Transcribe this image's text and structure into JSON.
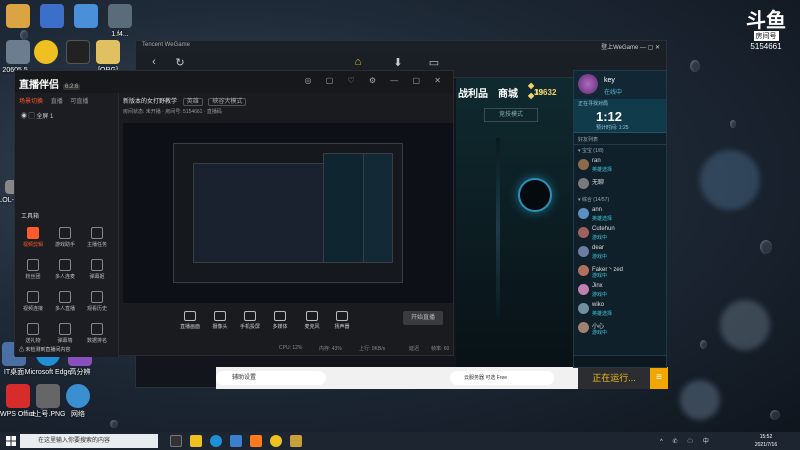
{
  "desktop": {
    "icons": [
      {
        "label": "",
        "color": "#d9a441"
      },
      {
        "label": "",
        "color": "#3b6fc9"
      },
      {
        "label": "",
        "color": "#4a90d9"
      },
      {
        "label": "1.f4...",
        "color": "#d04040"
      },
      {
        "label": "20605 5...",
        "color": "#5a6b7a"
      },
      {
        "label": "文件...",
        "color": "#5c8cd6"
      },
      {
        "label": "",
        "color": "#f0c020"
      },
      {
        "label": "",
        "color": "#222"
      },
      {
        "label": "",
        "color": "#e0c060"
      },
      {
        "label": "[ORG]",
        "color": "#c7a34b"
      },
      {
        "label": "202...",
        "color": "#6a7b8a"
      },
      {
        "label": "LOL-M...",
        "color": "#888"
      },
      {
        "label": "IT桌面",
        "color": "#4a6fa5"
      },
      {
        "label": "Microsoft Edge",
        "color": "#1f8fd6"
      },
      {
        "label": "高分辨",
        "color": "#8a4fbf"
      },
      {
        "label": "WPS Office",
        "color": "#d62c2c"
      },
      {
        "label": "d上号.PNG",
        "color": "#666"
      },
      {
        "label": "网络",
        "color": "#3a8fd0"
      }
    ]
  },
  "brand": {
    "mark": "斗鱼",
    "tag": "房间号",
    "room": "5154661"
  },
  "wegame": {
    "title": "Tencent WeGame",
    "window_right": "登上WeGame",
    "nav_icons": [
      "back-arrow-icon",
      "refresh-icon",
      "home-icon",
      "download-icon",
      "monitor-icon"
    ],
    "tabs": [
      "战利品",
      "商城"
    ],
    "stats": {
      "rp": "39",
      "be": "13632"
    },
    "game_button": "竞技模式",
    "assist_label": "辅助设置",
    "chip_label": "云服务器 可选 Free",
    "run_label": "正在运行...",
    "menu_icon": "≡"
  },
  "friends": {
    "name": "key",
    "status": "在线中",
    "timer_label": "正在寻找对局",
    "timer": "1:12",
    "timer_sub": "预计时间: 1:25",
    "search": "好友列表",
    "group1": "▾ 宝宝 (1/8)",
    "group2": "▾ 综合 (14/57)",
    "rows": [
      {
        "name": "ran",
        "status": "英雄选择",
        "color": "#8b6b4a"
      },
      {
        "name": "无聊",
        "status": "",
        "color": "#7a7a7a"
      },
      {
        "name": "ann",
        "status": "英雄选择",
        "color": "#5a8fc0"
      },
      {
        "name": "Cutehun",
        "status": "游戏中",
        "color": "#a06060"
      },
      {
        "name": "dear",
        "status": "游戏中",
        "color": "#6b7da0"
      },
      {
        "name": "Faker丶zed",
        "status": "游戏中",
        "color": "#b07060"
      },
      {
        "name": "Jinx",
        "status": "游戏中",
        "color": "#c080b0"
      },
      {
        "name": "wiko",
        "status": "英雄选择",
        "color": "#7090a0"
      },
      {
        "name": "小心",
        "status": "游戏中",
        "color": "#a08070"
      }
    ]
  },
  "stream": {
    "logo": "直播伴侣",
    "version": "6.2.6",
    "tabs": [
      "场景切换",
      "直播",
      "可直播"
    ],
    "scene": "◉  ▢  全屏 1",
    "room_title": "新版本的女打野教学",
    "category": "英雄",
    "tag": "峡谷大模式",
    "info": "房间状态: 未开播  ·  房间号: 5154661  ·  直播码",
    "tools_title": "工具箱",
    "tools": [
      {
        "label": "视频剪辑",
        "hot": true
      },
      {
        "label": "游戏助手",
        "hot": false
      },
      {
        "label": "主播任务",
        "hot": false
      },
      {
        "label": "粉丝团",
        "hot": false
      },
      {
        "label": "多人连麦",
        "hot": false
      },
      {
        "label": "弹幕姬",
        "hot": false
      },
      {
        "label": "视频连接",
        "hot": false
      },
      {
        "label": "多人直播",
        "hot": false
      },
      {
        "label": "观看历史",
        "hot": false
      },
      {
        "label": "送礼物",
        "hot": false
      },
      {
        "label": "弹幕墙",
        "hot": false
      },
      {
        "label": "数据排名",
        "hot": false
      }
    ],
    "warn": "⚠ 未检测到直播间内容",
    "controls": [
      "直播画面",
      "摄像头",
      "手机投屏",
      "多媒体",
      "麦克风",
      "扬声器"
    ],
    "start": "开始直播",
    "status": [
      "CPU: 12%",
      "内存: 43%",
      "上行: 0KB/s",
      "延迟",
      "帧率: 60"
    ]
  },
  "taskbar": {
    "search": "在这里输入你要搜索的内容",
    "tray": "^ ✆ ☁ 中",
    "time": "15:52",
    "date": "2021/7/16"
  }
}
